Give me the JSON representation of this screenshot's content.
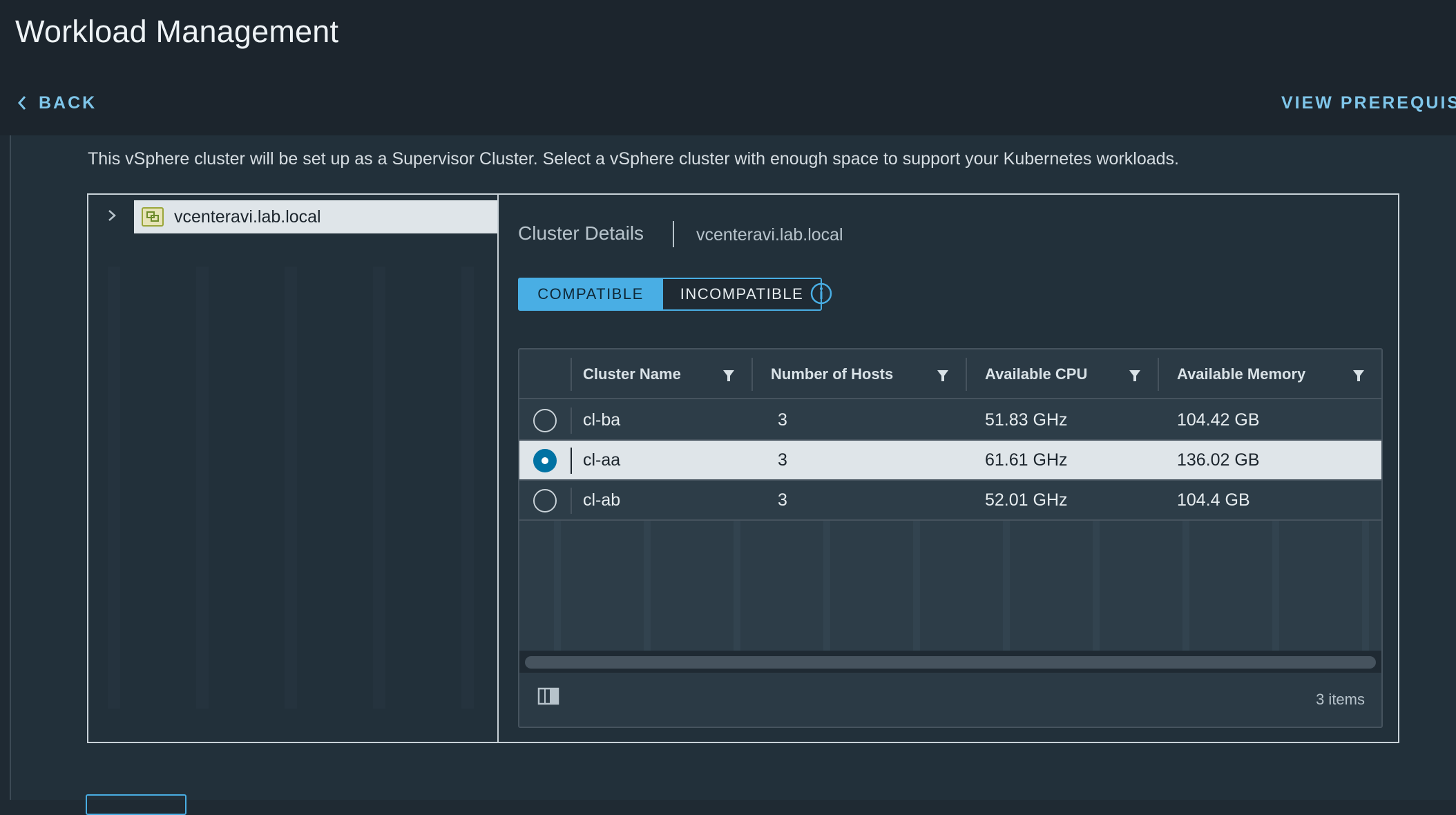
{
  "header": {
    "title": "Workload Management",
    "back_label": "BACK",
    "prereq_label": "VIEW PREREQUISI"
  },
  "intro_text": "This vSphere cluster will be set up as a Supervisor Cluster. Select a vSphere cluster with enough space to support your Kubernetes workloads.",
  "tree": {
    "node_label": "vcenteravi.lab.local",
    "icon": "datacenter-icon"
  },
  "details": {
    "title": "Cluster Details",
    "subtitle": "vcenteravi.lab.local",
    "tabs": [
      {
        "label": "COMPATIBLE",
        "active": true
      },
      {
        "label": "INCOMPATIBLE",
        "active": false
      }
    ]
  },
  "grid": {
    "columns": [
      "Cluster Name",
      "Number of Hosts",
      "Available CPU",
      "Available Memory"
    ],
    "rows": [
      {
        "name": "cl-ba",
        "hosts": "3",
        "cpu": "51.83 GHz",
        "memory": "104.42 GB",
        "selected": false
      },
      {
        "name": "cl-aa",
        "hosts": "3",
        "cpu": "61.61 GHz",
        "memory": "136.02 GB",
        "selected": true
      },
      {
        "name": "cl-ab",
        "hosts": "3",
        "cpu": "52.01 GHz",
        "memory": "104.4 GB",
        "selected": false
      }
    ],
    "footer_count": "3 items"
  },
  "colors": {
    "accent": "#49aee4",
    "link": "#7fc6ea",
    "selected_row": "#dfe5e9",
    "radio_selected": "#0072a3"
  }
}
